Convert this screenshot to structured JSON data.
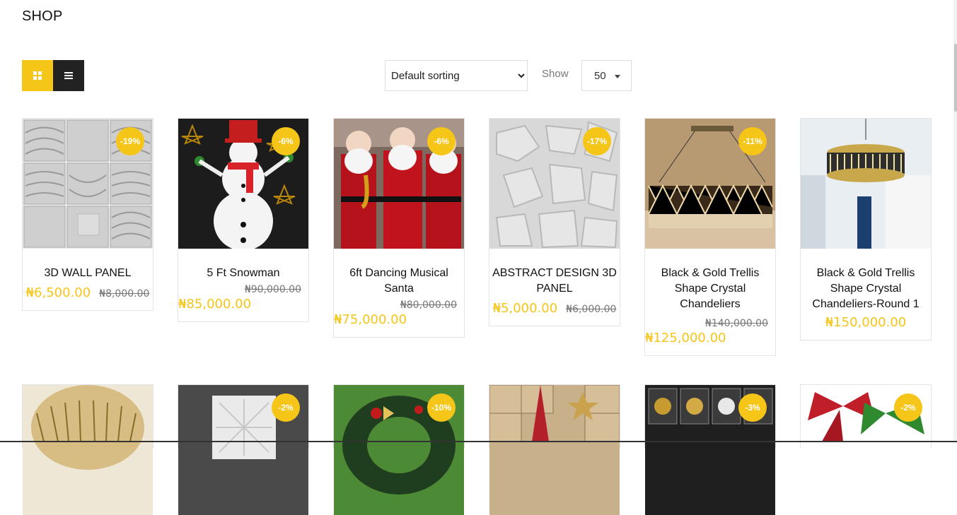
{
  "header": {
    "title": "SHOP"
  },
  "toolbar": {
    "sorting_value": "Default sorting",
    "sorting_options": [
      "Default sorting"
    ],
    "show_label": "Show",
    "show_value": "50"
  },
  "colors": {
    "accent": "#f5c518",
    "dark": "#222222"
  },
  "products": [
    {
      "title": "3D WALL PANEL",
      "price": "₦6,500.00",
      "old_price": "₦8,000.00",
      "badge": "-19%"
    },
    {
      "title": "5 Ft Snowman",
      "price": "₦85,000.00",
      "old_price": "₦90,000.00",
      "badge": "-6%"
    },
    {
      "title": "6ft Dancing Musical Santa",
      "price": "₦75,000.00",
      "old_price": "₦80,000.00",
      "badge": "-6%"
    },
    {
      "title": "ABSTRACT DESIGN 3D PANEL",
      "price": "₦5,000.00",
      "old_price": "₦6,000.00",
      "badge": "-17%"
    },
    {
      "title": "Black & Gold Trellis Shape Crystal Chandeliers",
      "price": "₦125,000.00",
      "old_price": "₦140,000.00",
      "badge": "-11%"
    },
    {
      "title": "Black & Gold Trellis Shape Crystal Chandeliers-Round 1",
      "price": "₦150,000.00",
      "old_price": "",
      "badge": ""
    },
    {
      "badge": ""
    },
    {
      "badge": "-2%"
    },
    {
      "badge": "-10%"
    },
    {
      "badge": ""
    },
    {
      "badge": "-3%"
    },
    {
      "badge": "-2%"
    }
  ]
}
